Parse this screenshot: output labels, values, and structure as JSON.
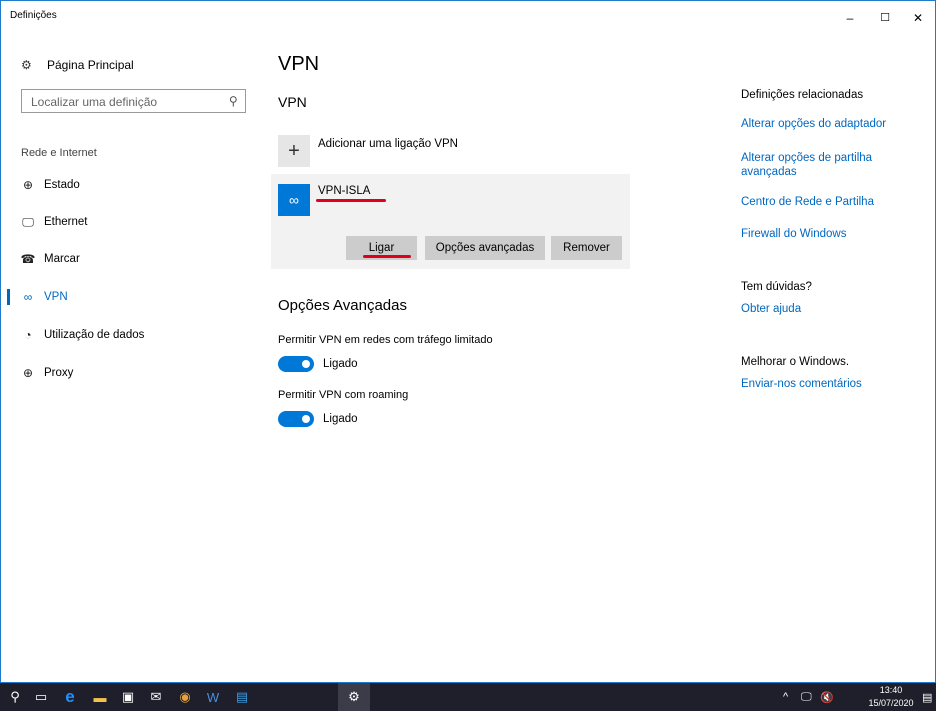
{
  "window": {
    "title": "Definições",
    "controls": {
      "minimize": "–",
      "maximize": "☐",
      "close": "✕"
    }
  },
  "sidebar": {
    "home": {
      "icon": "gear-icon",
      "label": "Página Principal"
    },
    "search": {
      "placeholder": "Localizar uma definição",
      "icon": "search-icon"
    },
    "section": "Rede e Internet",
    "items": [
      {
        "label": "Estado",
        "icon": "globe-status-icon",
        "active": false
      },
      {
        "label": "Ethernet",
        "icon": "ethernet-icon",
        "active": false
      },
      {
        "label": "Marcar",
        "icon": "dialup-icon",
        "active": false
      },
      {
        "label": "VPN",
        "icon": "vpn-icon",
        "active": true
      },
      {
        "label": "Utilização de dados",
        "icon": "data-usage-icon",
        "active": false
      },
      {
        "label": "Proxy",
        "icon": "globe-icon",
        "active": false
      }
    ]
  },
  "main": {
    "title": "VPN",
    "subtitle": "VPN",
    "add_vpn_label": "Adicionar uma ligação VPN",
    "connection": {
      "name": "VPN-ISLA",
      "buttons": {
        "connect": "Ligar",
        "advanced": "Opções avançadas",
        "remove": "Remover"
      }
    },
    "advanced_title": "Opções Avançadas",
    "options": [
      {
        "label": "Permitir VPN em redes com tráfego limitado",
        "state": "Ligado",
        "on": true
      },
      {
        "label": "Permitir VPN com roaming",
        "state": "Ligado",
        "on": true
      }
    ]
  },
  "related": {
    "heading": "Definições relacionadas",
    "links": [
      "Alterar opções do adaptador",
      "Alterar opções de partilha avançadas",
      "Centro de Rede e Partilha",
      "Firewall do Windows"
    ],
    "help_heading": "Tem dúvidas?",
    "help_link": "Obter ajuda",
    "improve_heading": "Melhorar o Windows.",
    "improve_link": "Enviar-nos comentários"
  },
  "taskbar": {
    "time": "13:40",
    "date": "15/07/2020"
  },
  "colors": {
    "accent": "#0078d7",
    "link": "#0067c0",
    "annotation": "#e0001b",
    "taskbar": "#1f1f2b"
  }
}
